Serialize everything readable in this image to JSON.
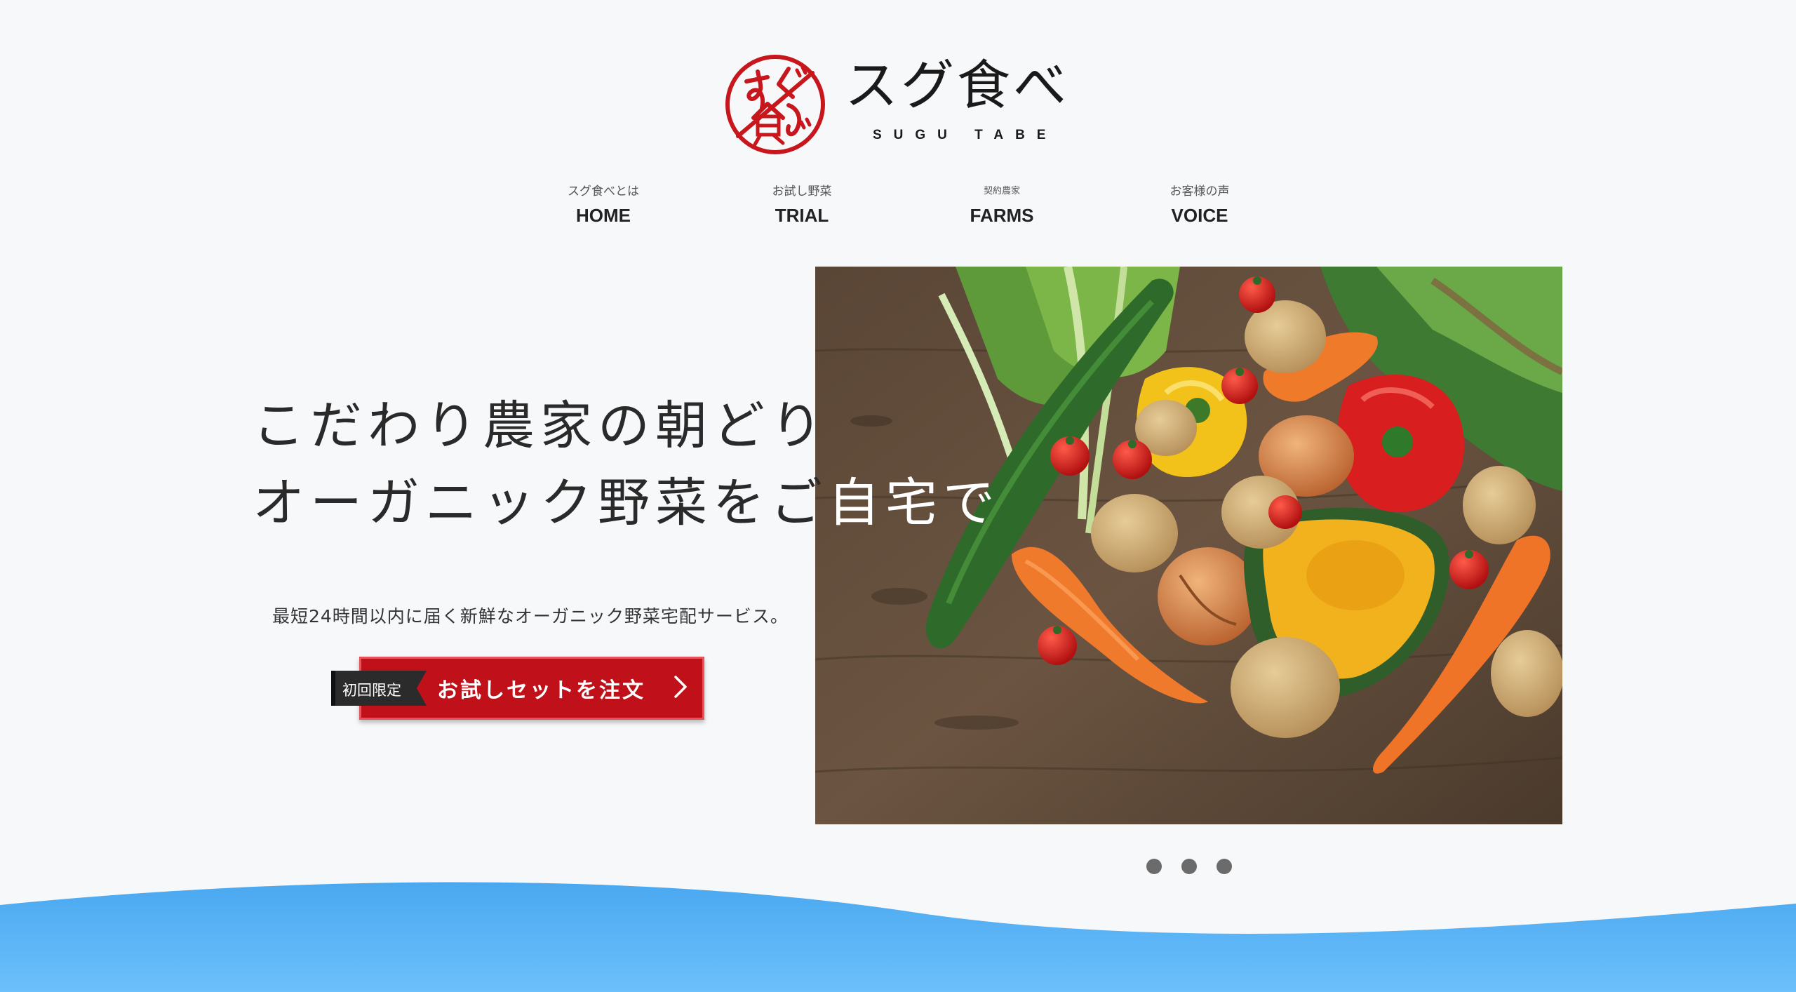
{
  "brand": {
    "name": "スグ食べ",
    "romaji": "SUGU TABE",
    "mark_text": "すぐ食べ",
    "logo_color": "#c8161d"
  },
  "nav": [
    {
      "sub": "スグ食べとは",
      "label": "HOME"
    },
    {
      "sub": "お試し野菜",
      "label": "TRIAL"
    },
    {
      "sub": "契約農家",
      "label": "FARMS"
    },
    {
      "sub": "お客様の声",
      "label": "VOICE"
    }
  ],
  "hero": {
    "headline_line1": "こだわり農家の朝どり",
    "headline_line2_a": "オーガニック野菜をご",
    "headline_line2_b": "自宅で",
    "subtext": "最短24時間以内に届く新鮮なオーガニック野菜宅配サービス。",
    "photo_icon": "vegetables-photo"
  },
  "cta": {
    "tag": "初回限定",
    "label": "お試しセットを注文",
    "arrow_icon": "chevron-right-icon",
    "color": "#c0101a"
  },
  "slider": {
    "dots": 3
  },
  "colors": {
    "background": "#f7f8fa",
    "wave_top": "#4aa8f0",
    "wave_bottom": "#6cc0fb"
  }
}
